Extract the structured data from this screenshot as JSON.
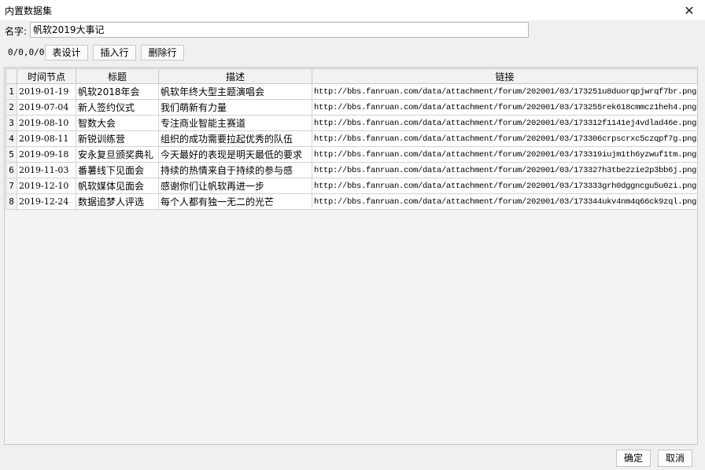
{
  "window": {
    "title": "内置数据集",
    "close_glyph": "✕"
  },
  "name_field": {
    "label": "名字:",
    "value": "帆软2019大事记"
  },
  "toolbar": {
    "position": "0/0,0/0",
    "table_design": "表设计",
    "insert_row": "插入行",
    "delete_row": "删除行"
  },
  "table": {
    "columns": [
      "时间节点",
      "标题",
      "描述",
      "链接"
    ],
    "rows": [
      {
        "n": "1",
        "date": "2019-01-19",
        "title": "帆软2018年会",
        "desc": "帆软年终大型主题演唱会",
        "link": "http://bbs.fanruan.com/data/attachment/forum/202001/03/173251u8duorqpjwrqf7br.png"
      },
      {
        "n": "2",
        "date": "2019-07-04",
        "title": "新人签约仪式",
        "desc": "我们萌新有力量",
        "link": "http://bbs.fanruan.com/data/attachment/forum/202001/03/173255rek618cmmcz1heh4.png"
      },
      {
        "n": "3",
        "date": "2019-08-10",
        "title": "智数大会",
        "desc": "专注商业智能主赛道",
        "link": "http://bbs.fanruan.com/data/attachment/forum/202001/03/173312f1141ej4vdlad46e.png"
      },
      {
        "n": "4",
        "date": "2019-08-11",
        "title": "新锐训练营",
        "desc": "组织的成功需要拉起优秀的队伍",
        "link": "http://bbs.fanruan.com/data/attachment/forum/202001/03/173306crpscrxc5czqpf7g.png"
      },
      {
        "n": "5",
        "date": "2019-09-18",
        "title": "安永复旦颁奖典礼",
        "desc": "今天最好的表现是明天最低的要求",
        "link": "http://bbs.fanruan.com/data/attachment/forum/202001/03/173319iujm1th6yzwuf1tm.png"
      },
      {
        "n": "6",
        "date": "2019-11-03",
        "title": "番薯线下见面会",
        "desc": "持续的热情来自于持续的参与感",
        "link": "http://bbs.fanruan.com/data/attachment/forum/202001/03/173327h3tbe2zie2p3bb6j.png"
      },
      {
        "n": "7",
        "date": "2019-12-10",
        "title": "帆软媒体见面会",
        "desc": "感谢你们让帆软再进一步",
        "link": "http://bbs.fanruan.com/data/attachment/forum/202001/03/173333grh0dggncgu5u0zi.png"
      },
      {
        "n": "8",
        "date": "2019-12-24",
        "title": "数据追梦人评选",
        "desc": "每个人都有独一无二的光芒",
        "link": "http://bbs.fanruan.com/data/attachment/forum/202001/03/173344ukv4nm4q66ck9zql.png"
      }
    ]
  },
  "footer": {
    "ok": "确定",
    "cancel": "取消"
  }
}
